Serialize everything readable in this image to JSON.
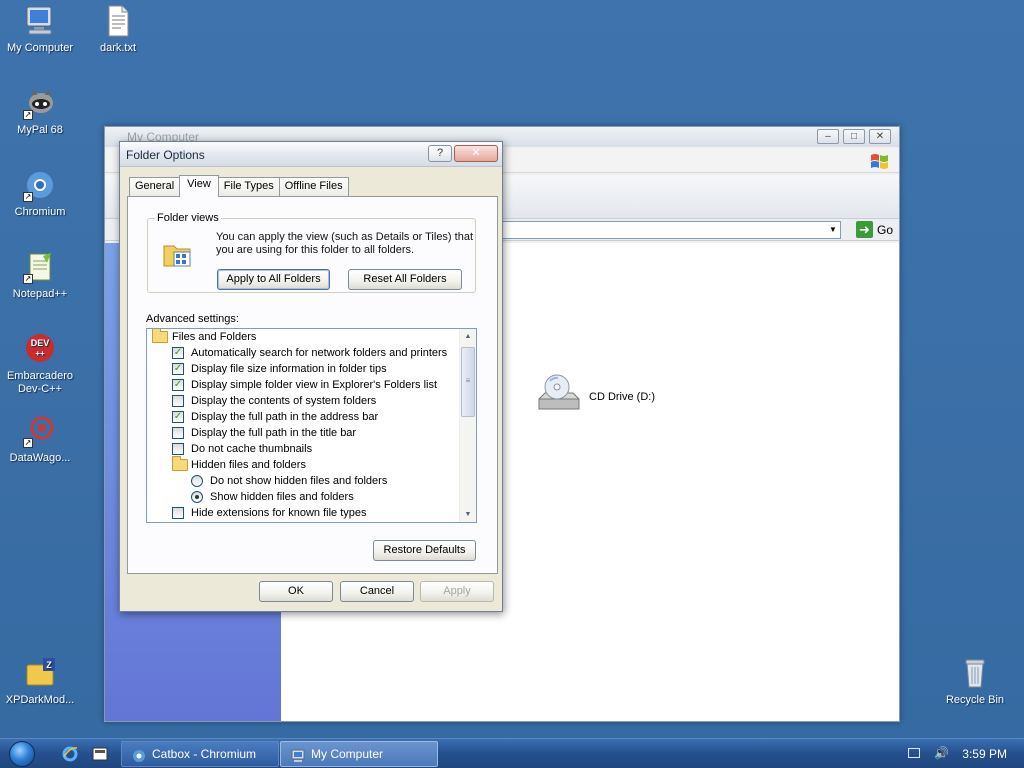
{
  "desktop": {
    "icons": [
      {
        "label": "My Computer"
      },
      {
        "label": "dark.txt"
      },
      {
        "label": "MyPal 68"
      },
      {
        "label": "Chromium"
      },
      {
        "label": "Notepad++"
      },
      {
        "label": "Embarcadero Dev-C++"
      },
      {
        "label": "DataWago..."
      },
      {
        "label": "XPDarkMod..."
      },
      {
        "label": "Recycle Bin"
      }
    ]
  },
  "explorer": {
    "title": "My Computer",
    "address_go": "Go",
    "cd_drive_label": "CD Drive (D:)"
  },
  "dialog": {
    "title": "Folder Options",
    "help_btn": "?",
    "close_btn": "✕",
    "tabs": [
      {
        "label": "General"
      },
      {
        "label": "View"
      },
      {
        "label": "File Types"
      },
      {
        "label": "Offline Files"
      }
    ],
    "folder_views": {
      "legend": "Folder views",
      "text": "You can apply the view (such as Details or Tiles) that you are using for this folder to all folders.",
      "apply_all": "Apply to All Folders",
      "reset_all": "Reset All Folders"
    },
    "advanced_label": "Advanced settings:",
    "advanced_items": [
      {
        "type": "folder",
        "label": "Files and Folders",
        "indent": 0
      },
      {
        "type": "check",
        "label": "Automatically search for network folders and printers",
        "checked": true
      },
      {
        "type": "check",
        "label": "Display file size information in folder tips",
        "checked": true
      },
      {
        "type": "check",
        "label": "Display simple folder view in Explorer's Folders list",
        "checked": true
      },
      {
        "type": "check",
        "label": "Display the contents of system folders",
        "checked": false
      },
      {
        "type": "check",
        "label": "Display the full path in the address bar",
        "checked": true
      },
      {
        "type": "check",
        "label": "Display the full path in the title bar",
        "checked": false
      },
      {
        "type": "check",
        "label": "Do not cache thumbnails",
        "checked": false
      },
      {
        "type": "folder",
        "label": "Hidden files and folders",
        "indent": 1
      },
      {
        "type": "radio",
        "label": "Do not show hidden files and folders",
        "checked": false
      },
      {
        "type": "radio",
        "label": "Show hidden files and folders",
        "checked": true
      },
      {
        "type": "check",
        "label": "Hide extensions for known file types",
        "checked": false
      }
    ],
    "restore_defaults": "Restore Defaults",
    "ok": "OK",
    "cancel": "Cancel",
    "apply": "Apply"
  },
  "taskbar": {
    "tasks": [
      {
        "label": "Catbox - Chromium",
        "active": false
      },
      {
        "label": "My Computer",
        "active": true
      }
    ],
    "clock": "3:59 PM"
  }
}
